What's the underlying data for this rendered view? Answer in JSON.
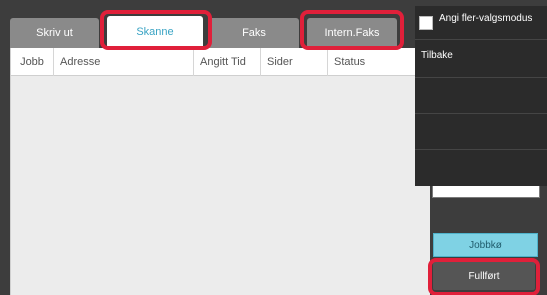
{
  "tabs": [
    {
      "label": "Skriv ut",
      "active": false
    },
    {
      "label": "Skanne",
      "active": true
    },
    {
      "label": "Faks",
      "active": false
    },
    {
      "label": "Intern.Faks",
      "active": false
    }
  ],
  "table": {
    "columns": [
      "Jobb",
      "Adresse",
      "Angitt Tid",
      "Sider",
      "Status"
    ]
  },
  "menu": {
    "multi_select_label": "Angi fler-valgsmodus",
    "multi_select_checked": false,
    "back_label": "Tilbake"
  },
  "side_panel": {
    "job_queue_label": "Jobbkø",
    "done_label": "Fullført"
  },
  "colors": {
    "accent": "#3aa4c4",
    "highlight": "#e0203a",
    "queue_button": "#7fd2e4"
  }
}
